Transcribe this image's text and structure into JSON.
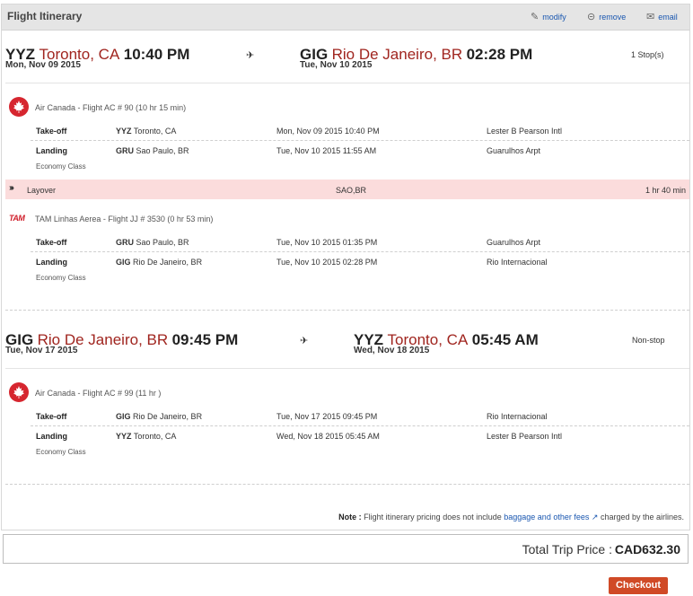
{
  "header": {
    "title": "Flight Itinerary",
    "actions": {
      "modify": "modify",
      "remove": "remove",
      "email": "email"
    }
  },
  "outbound": {
    "depart": {
      "code": "YYZ",
      "city": "Toronto, CA",
      "time": "10:40 PM",
      "date": "Mon, Nov 09 2015"
    },
    "arrive": {
      "code": "GIG",
      "city": "Rio De Janeiro, BR",
      "time": "02:28 PM",
      "date": "Tue, Nov 10 2015"
    },
    "stops": "1 Stop(s)",
    "segments": [
      {
        "carrier": "Air Canada - Flight AC # 90 (10 hr 15 min)",
        "takeoff": {
          "label": "Take-off",
          "code": "YYZ",
          "city": "Toronto, CA",
          "datetime": "Mon, Nov 09 2015 10:40 PM",
          "airport": "Lester B Pearson Intl"
        },
        "landing": {
          "label": "Landing",
          "code": "GRU",
          "city": "Sao Paulo, BR",
          "datetime": "Tue, Nov 10 2015 11:55 AM",
          "airport": "Guarulhos Arpt"
        },
        "class": "Economy Class"
      },
      {
        "carrier": "TAM Linhas Aerea - Flight JJ # 3530 (0 hr 53 min)",
        "takeoff": {
          "label": "Take-off",
          "code": "GRU",
          "city": "Sao Paulo, BR",
          "datetime": "Tue, Nov 10 2015 01:35 PM",
          "airport": "Guarulhos Arpt"
        },
        "landing": {
          "label": "Landing",
          "code": "GIG",
          "city": "Rio De Janeiro, BR",
          "datetime": "Tue, Nov 10 2015 02:28 PM",
          "airport": "Rio Internacional"
        },
        "class": "Economy Class"
      }
    ],
    "layover": {
      "label": "Layover",
      "place": "SAO,BR",
      "duration": "1 hr 40 min"
    }
  },
  "inbound": {
    "depart": {
      "code": "GIG",
      "city": "Rio De Janeiro, BR",
      "time": "09:45 PM",
      "date": "Tue, Nov 17 2015"
    },
    "arrive": {
      "code": "YYZ",
      "city": "Toronto, CA",
      "time": "05:45 AM",
      "date": "Wed, Nov 18 2015"
    },
    "stops": "Non-stop",
    "segments": [
      {
        "carrier": "Air Canada - Flight AC # 99 (11 hr )",
        "takeoff": {
          "label": "Take-off",
          "code": "GIG",
          "city": "Rio De Janeiro, BR",
          "datetime": "Tue, Nov 17 2015 09:45 PM",
          "airport": "Rio Internacional"
        },
        "landing": {
          "label": "Landing",
          "code": "YYZ",
          "city": "Toronto, CA",
          "datetime": "Wed, Nov 18 2015 05:45 AM",
          "airport": "Lester B Pearson Intl"
        },
        "class": "Economy Class"
      }
    ]
  },
  "logos": {
    "tam": "TAM"
  },
  "note": {
    "label": "Note :",
    "text": "Flight itinerary pricing does not include",
    "link": "baggage and other fees",
    "suffix": "charged by the airlines."
  },
  "total": {
    "label": "Total Trip Price :",
    "value": "CAD632.30"
  },
  "checkout": "Checkout",
  "icons": {
    "modify": "edit-icon",
    "remove": "remove-icon",
    "email": "email-icon",
    "plane": "plane-icon",
    "air_canada": "maple-leaf-icon",
    "layover": "double-chevron-icon",
    "external": "external-link-icon"
  },
  "colors": {
    "city": "#a0251f",
    "layover_bg": "#fbdcdc",
    "checkout_bg": "#d04a26",
    "link": "#1a57b0",
    "air_canada": "#d6262f"
  }
}
